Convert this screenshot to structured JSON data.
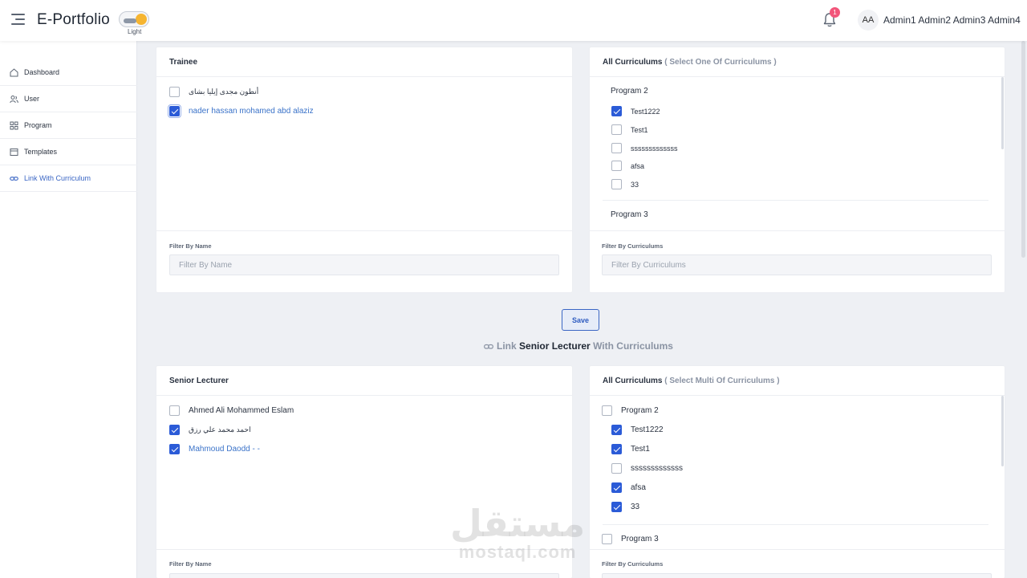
{
  "header": {
    "brand": "E-Portfolio",
    "theme_label": "Light",
    "notifications_count": "1",
    "avatar_initials": "AA",
    "username": "Admin1 Admin2 Admin3 Admin4"
  },
  "sidebar": {
    "items": [
      {
        "label": "Dashboard",
        "icon": "home-icon"
      },
      {
        "label": "User",
        "icon": "users-icon"
      },
      {
        "label": "Program",
        "icon": "grid-icon"
      },
      {
        "label": "Templates",
        "icon": "template-icon"
      },
      {
        "label": "Link With Curriculum",
        "icon": "link-icon",
        "active": true
      }
    ]
  },
  "trainee_panel": {
    "title": "Trainee",
    "items": [
      {
        "name": "أنطون مجدى إيليا بشاى",
        "checked": false
      },
      {
        "name": "nader hassan mohamed abd alaziz",
        "checked": true
      }
    ],
    "filter_label": "Filter By Name",
    "filter_placeholder": "Filter By Name"
  },
  "curriculums_single": {
    "title": "All Curriculums",
    "hint": "( Select One Of Curriculums )",
    "groups": [
      {
        "name": "Program 2",
        "items": [
          {
            "name": "Test1222",
            "checked": true
          },
          {
            "name": "Test1",
            "checked": false
          },
          {
            "name": "sssssssssssss",
            "checked": false
          },
          {
            "name": "afsa",
            "checked": false
          },
          {
            "name": "33",
            "checked": false
          }
        ]
      },
      {
        "name": "Program 3",
        "items": []
      }
    ],
    "filter_label": "Filter By Curriculums",
    "filter_placeholder": "Filter By Curriculums"
  },
  "save_label": "Save",
  "section_title": {
    "prefix": "Link",
    "emphasis": "Senior Lecturer",
    "suffix": "With Curriculums"
  },
  "lecturer_panel": {
    "title": "Senior Lecturer",
    "items": [
      {
        "name": "Ahmed Ali Mohammed Eslam",
        "checked": false
      },
      {
        "name": "احمد محمد علي رزق",
        "checked": true
      },
      {
        "name": "Mahmoud Daodd - -",
        "checked": true
      }
    ],
    "filter_label": "Filter By Name"
  },
  "curriculums_multi": {
    "title": "All Curriculums",
    "hint": "( Select Multi Of Curriculums )",
    "groups": [
      {
        "name": "Program 2",
        "checked": false,
        "items": [
          {
            "name": "Test1222",
            "checked": true
          },
          {
            "name": "Test1",
            "checked": true
          },
          {
            "name": "sssssssssssss",
            "checked": false
          },
          {
            "name": "afsa",
            "checked": true
          },
          {
            "name": "33",
            "checked": true
          }
        ]
      },
      {
        "name": "Program 3",
        "checked": false,
        "items": []
      }
    ],
    "filter_label": "Filter By Curriculums"
  },
  "watermark": {
    "arabic": "مستقل",
    "latin": "mostaql.com"
  },
  "colors": {
    "accent": "#2b5bd7",
    "link": "#3b73c9",
    "badge": "#f2557a",
    "background": "#eef0f4"
  }
}
